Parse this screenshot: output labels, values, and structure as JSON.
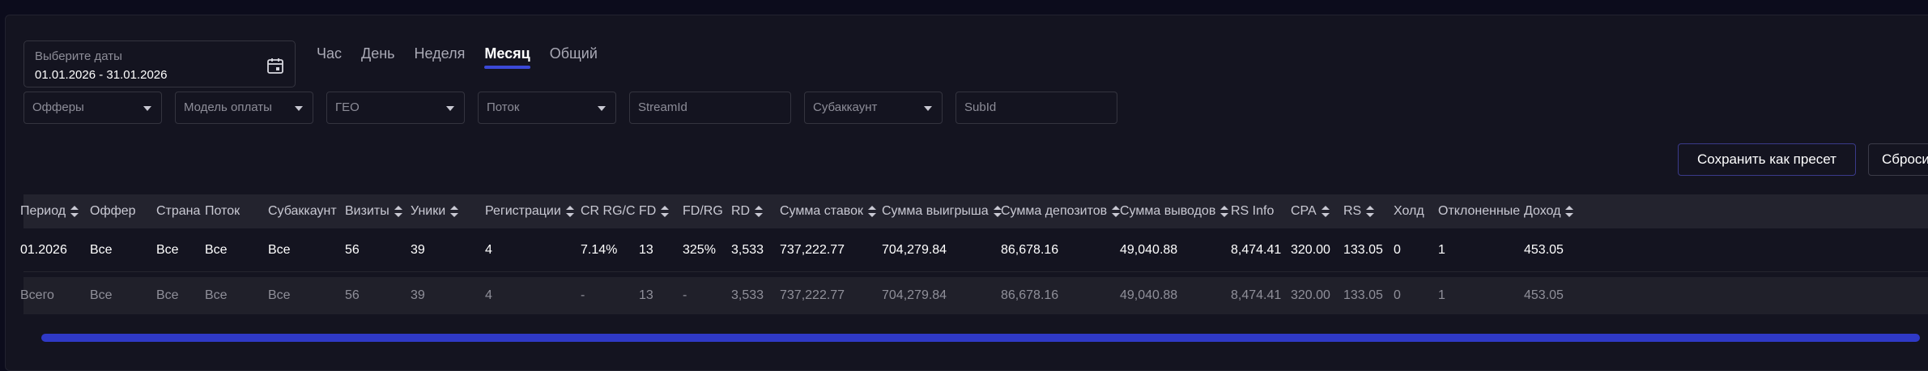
{
  "date_picker": {
    "label": "Выберите даты",
    "value": "01.01.2026 - 31.01.2026",
    "icon": "calendar-icon"
  },
  "tabs": [
    {
      "label": "Час",
      "active": false
    },
    {
      "label": "День",
      "active": false
    },
    {
      "label": "Неделя",
      "active": false
    },
    {
      "label": "Месяц",
      "active": true
    },
    {
      "label": "Общий",
      "active": false
    }
  ],
  "filters": {
    "offers": "Офферы",
    "payment_model": "Модель оплаты",
    "geo": "ГЕО",
    "stream": "Поток",
    "stream_id": "StreamId",
    "subaccount": "Субаккаунт",
    "subid": "SubId"
  },
  "buttons": {
    "save_preset": "Сохранить как пресет",
    "reset": "Сброси"
  },
  "table": {
    "columns": [
      {
        "key": "period",
        "label": "Период",
        "sortable": true
      },
      {
        "key": "offer",
        "label": "Оффер",
        "sortable": false
      },
      {
        "key": "country",
        "label": "Страна",
        "sortable": false
      },
      {
        "key": "stream",
        "label": "Поток",
        "sortable": false
      },
      {
        "key": "subaccount",
        "label": "Субаккаунт",
        "sortable": false
      },
      {
        "key": "visits",
        "label": "Визиты",
        "sortable": true
      },
      {
        "key": "uniques",
        "label": "Уники",
        "sortable": true
      },
      {
        "key": "registrations",
        "label": "Регистрации",
        "sortable": true
      },
      {
        "key": "cr",
        "label": "CR RG/C",
        "sortable": false
      },
      {
        "key": "fd",
        "label": "FD",
        "sortable": true
      },
      {
        "key": "fdrg",
        "label": "FD/RG",
        "sortable": false
      },
      {
        "key": "rd",
        "label": "RD",
        "sortable": true
      },
      {
        "key": "bets",
        "label": "Сумма ставок",
        "sortable": true
      },
      {
        "key": "wins",
        "label": "Сумма выигрыша",
        "sortable": true
      },
      {
        "key": "deposits",
        "label": "Сумма депозитов",
        "sortable": true
      },
      {
        "key": "withdrawals",
        "label": "Сумма выводов",
        "sortable": true
      },
      {
        "key": "rs_info",
        "label": "RS Info",
        "sortable": false
      },
      {
        "key": "cpa",
        "label": "CPA",
        "sortable": true
      },
      {
        "key": "rs",
        "label": "RS",
        "sortable": true
      },
      {
        "key": "hold",
        "label": "Холд",
        "sortable": false
      },
      {
        "key": "rejected",
        "label": "Отклоненные",
        "sortable": false
      },
      {
        "key": "income",
        "label": "Доход",
        "sortable": true
      }
    ],
    "rows": [
      [
        "01.2026",
        "Все",
        "Все",
        "Все",
        "Все",
        "56",
        "39",
        "4",
        "7.14%",
        "13",
        "325%",
        "3,533",
        "737,222.77",
        "704,279.84",
        "86,678.16",
        "49,040.88",
        "8,474.41",
        "320.00",
        "133.05",
        "0",
        "1",
        "453.05"
      ]
    ],
    "total_row": [
      "Всего",
      "Все",
      "Все",
      "Все",
      "Все",
      "56",
      "39",
      "4",
      "-",
      "13",
      "-",
      "3,533",
      "737,222.77",
      "704,279.84",
      "86,678.16",
      "49,040.88",
      "8,474.41",
      "320.00",
      "133.05",
      "0",
      "1",
      "453.05"
    ]
  }
}
